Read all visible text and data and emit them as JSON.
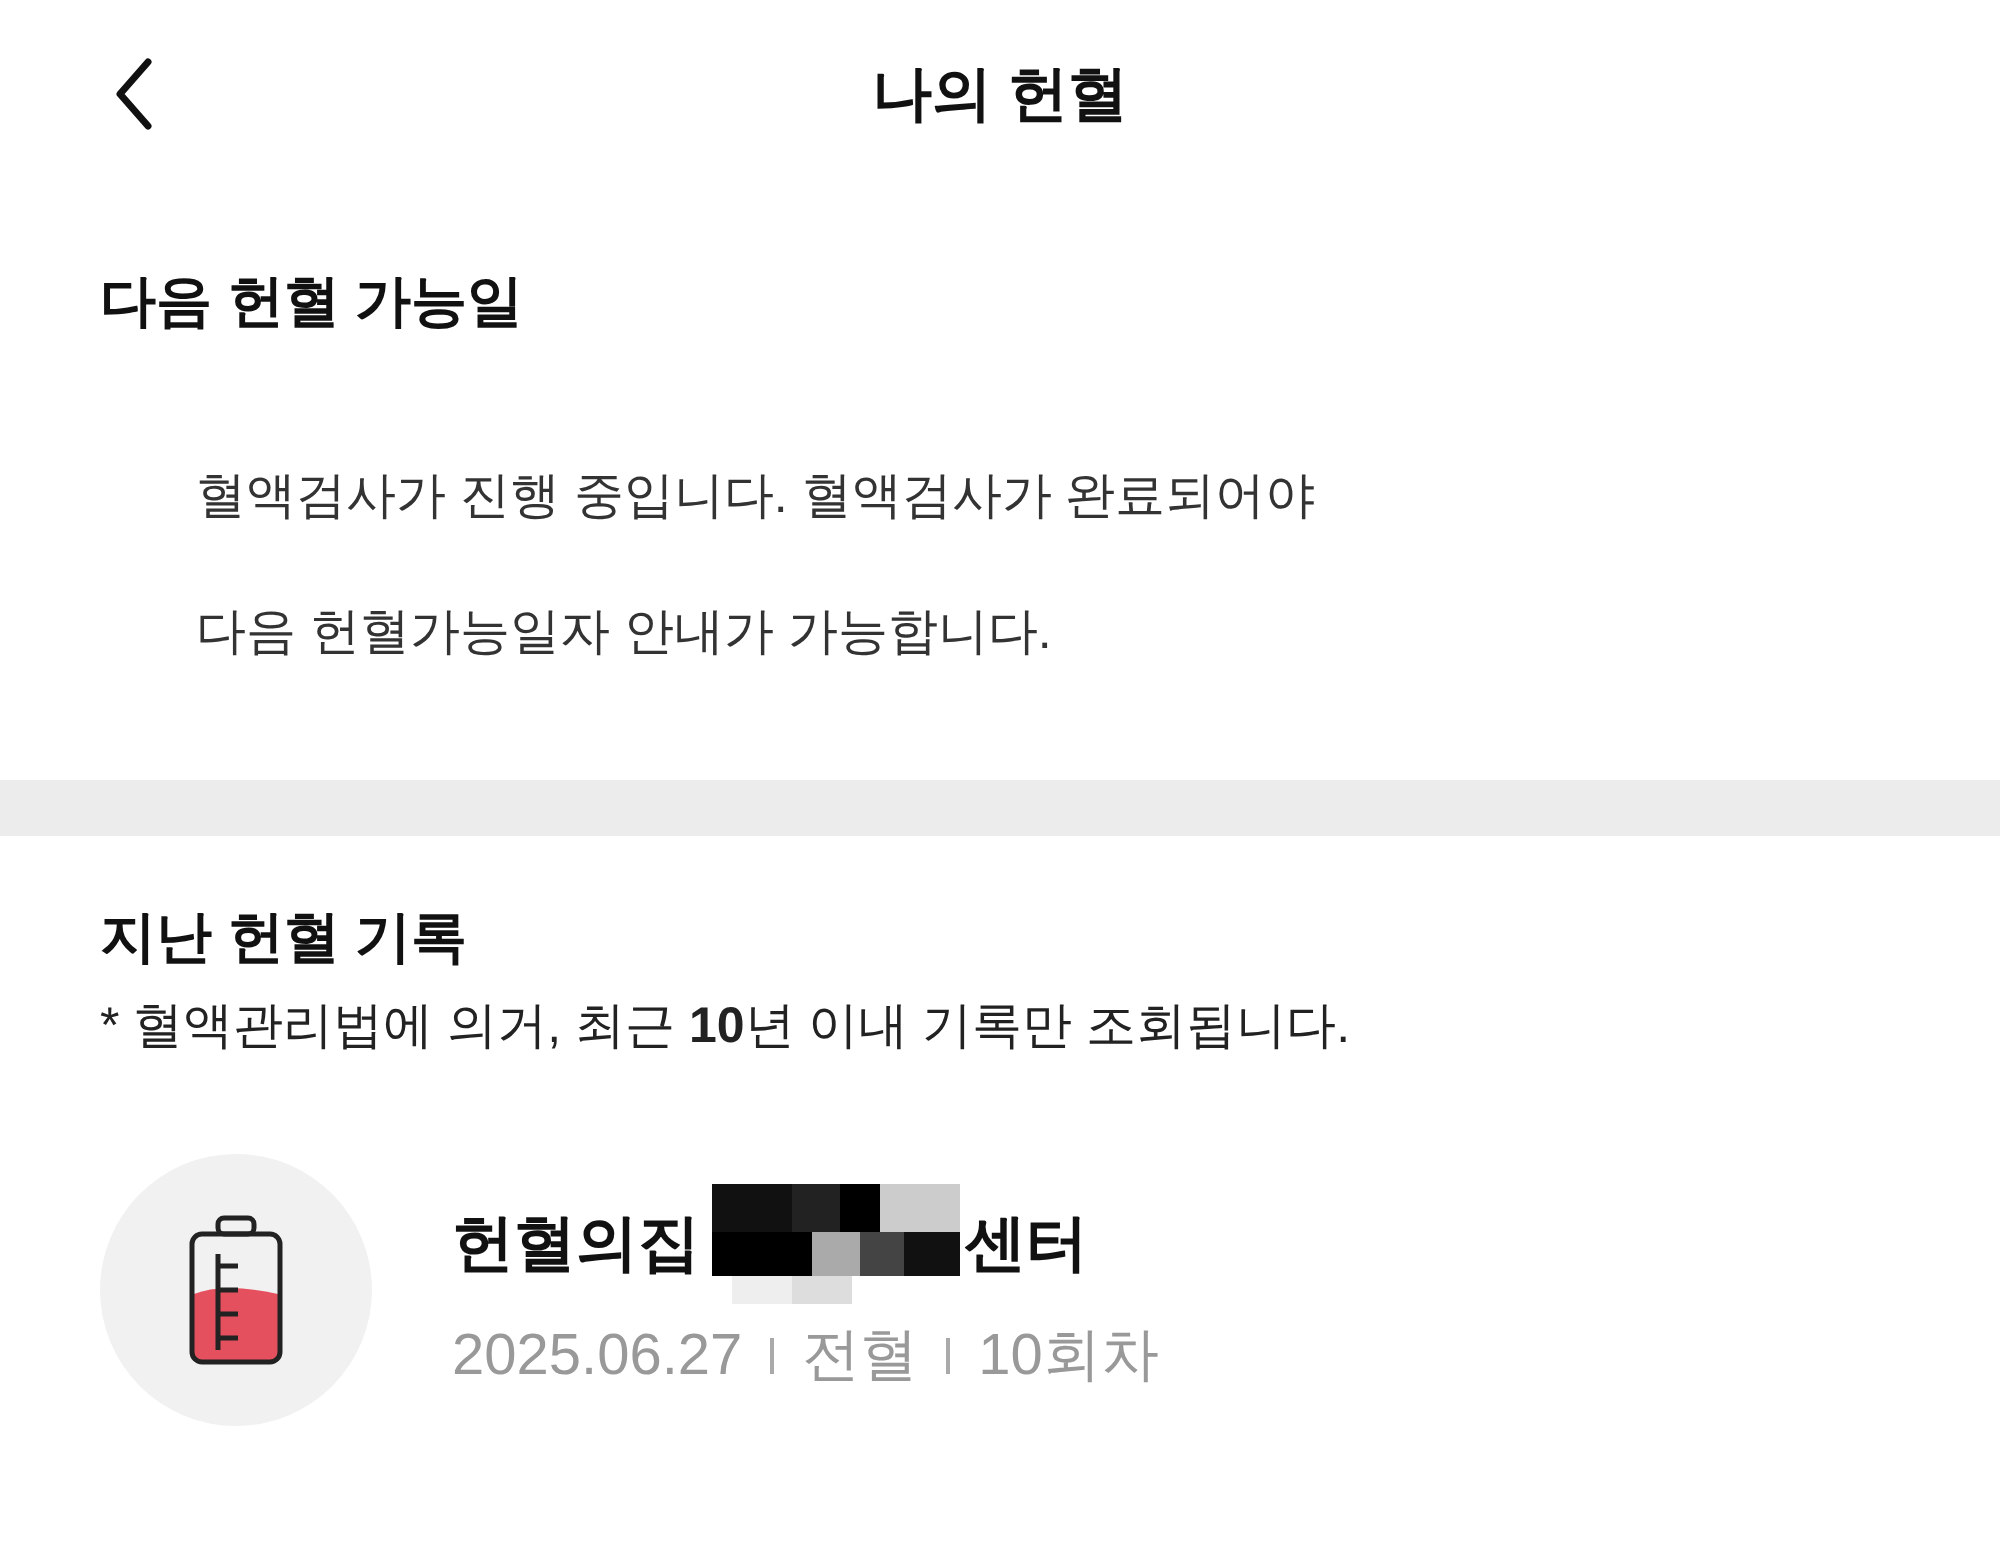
{
  "header": {
    "title": "나의 헌혈"
  },
  "next_donation": {
    "heading": "다음 헌혈 가능일",
    "message_lines": [
      "혈액검사가 진행 중입니다. 혈액검사가 완료되어야",
      "다음 헌혈가능일자 안내가 가능합니다."
    ]
  },
  "history": {
    "heading": "지난 헌혈 기록",
    "note": "* 혈액관리법에 의거, 최근 **10**년 이내 기록만 조회됩니다.",
    "records": [
      {
        "center_prefix": "헌혈의집",
        "center_suffix": "센터",
        "redacted": true,
        "date": "2025.06.27",
        "type": "전혈",
        "count": "10회차"
      }
    ]
  }
}
